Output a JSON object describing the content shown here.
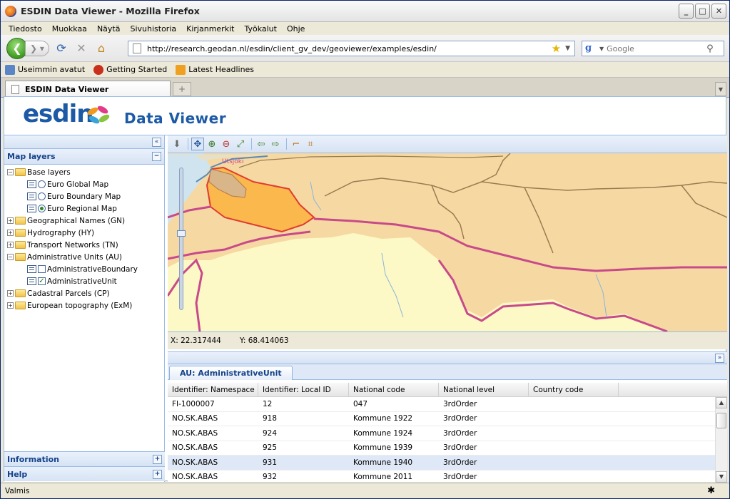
{
  "window": {
    "title": "ESDIN Data Viewer - Mozilla Firefox",
    "buttons": {
      "minimize": "_",
      "maximize": "□",
      "close": "✕"
    }
  },
  "menu": [
    "Tiedosto",
    "Muokkaa",
    "Näytä",
    "Sivuhistoria",
    "Kirjanmerkit",
    "Työkalut",
    "Ohje"
  ],
  "nav": {
    "url": "http://research.geodan.nl/esdin/client_gv_dev/geoviewer/examples/esdin/",
    "search_placeholder": "Google"
  },
  "bookmarks": [
    "Useimmin avatut",
    "Getting Started",
    "Latest Headlines"
  ],
  "tabs": [
    {
      "label": "ESDIN Data Viewer"
    }
  ],
  "banner": {
    "logo": "esdin",
    "title": "Data Viewer"
  },
  "left_panel": {
    "header": "Map layers",
    "tree": {
      "base": "Base layers",
      "base_items": [
        "Euro Global Map",
        "Euro Boundary Map",
        "Euro Regional Map"
      ],
      "gn": "Geographical Names (GN)",
      "hy": "Hydrography (HY)",
      "tn": "Transport Networks (TN)",
      "au": "Administrative Units (AU)",
      "au_items": [
        "AdministrativeBoundary",
        "AdministrativeUnit"
      ],
      "cp": "Cadastral Parcels (CP)",
      "exm": "European topography (ExM)"
    },
    "selected_base": "Euro Regional Map",
    "checked_au": "AdministrativeUnit",
    "footer": [
      "Information",
      "Help"
    ]
  },
  "map": {
    "label": "Utsjoki",
    "coords": {
      "x": "X: 22.317444",
      "y": "Y: 68.414063"
    }
  },
  "bottom_panel": {
    "tab": "AU: AdministrativeUnit",
    "columns": [
      "Identifier: Namespace",
      "Identifier: Local ID",
      "National code",
      "National level",
      "Country code"
    ],
    "rows": [
      [
        "FI-1000007",
        "12",
        "047",
        "3rdOrder",
        ""
      ],
      [
        "NO.SK.ABAS",
        "918",
        "Kommune 1922",
        "3rdOrder",
        ""
      ],
      [
        "NO.SK.ABAS",
        "924",
        "Kommune 1924",
        "3rdOrder",
        ""
      ],
      [
        "NO.SK.ABAS",
        "925",
        "Kommune 1939",
        "3rdOrder",
        ""
      ],
      [
        "NO.SK.ABAS",
        "931",
        "Kommune 1940",
        "3rdOrder",
        ""
      ],
      [
        "NO.SK.ABAS",
        "932",
        "Kommune 2011",
        "3rdOrder",
        ""
      ]
    ],
    "selected_row": 4
  },
  "status": "Valmis"
}
